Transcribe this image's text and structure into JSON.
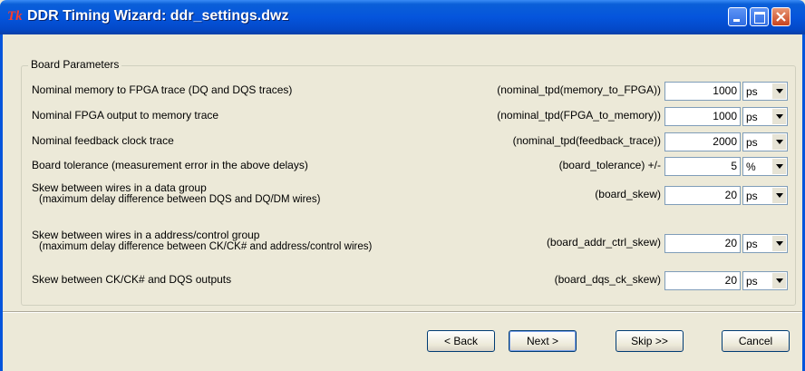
{
  "window": {
    "title": "DDR Timing Wizard: ddr_settings.dwz",
    "app_icon": "Tk",
    "controls": [
      "minimize-icon",
      "maximize-icon",
      "close-icon"
    ]
  },
  "group": {
    "title": "Board Parameters",
    "rows": [
      {
        "label": "Nominal memory to FPGA trace (DQ and DQS traces)",
        "sublabel": "",
        "param": "(nominal_tpd(memory_to_FPGA))",
        "value": "1000",
        "unit": "ps"
      },
      {
        "label": "Nominal FPGA output to memory trace",
        "sublabel": "",
        "param": "(nominal_tpd(FPGA_to_memory))",
        "value": "1000",
        "unit": "ps"
      },
      {
        "label": "Nominal feedback clock trace",
        "sublabel": "",
        "param": "(nominal_tpd(feedback_trace))",
        "value": "2000",
        "unit": "ps"
      },
      {
        "label": "Board tolerance (measurement error in the above delays)",
        "sublabel": "",
        "param": "(board_tolerance)  +/-",
        "value": "5",
        "unit": "%"
      },
      {
        "label": "Skew between wires in a data group",
        "sublabel": "(maximum delay difference between DQS and DQ/DM wires)",
        "param": "(board_skew)",
        "value": "20",
        "unit": "ps"
      },
      {
        "label": "Skew between wires in a address/control group",
        "sublabel": "(maximum delay difference between CK/CK# and address/control wires)",
        "param": "(board_addr_ctrl_skew)",
        "value": "20",
        "unit": "ps"
      },
      {
        "label": "Skew between CK/CK# and DQS outputs",
        "sublabel": "",
        "param": "(board_dqs_ck_skew)",
        "value": "20",
        "unit": "ps"
      }
    ]
  },
  "buttons": {
    "back": "< Back",
    "next": "Next >",
    "skip": "Skip >>",
    "cancel": "Cancel"
  },
  "colors": {
    "title_bar": "#0555dc",
    "face": "#ece9d8",
    "close_button": "#c8431f"
  }
}
